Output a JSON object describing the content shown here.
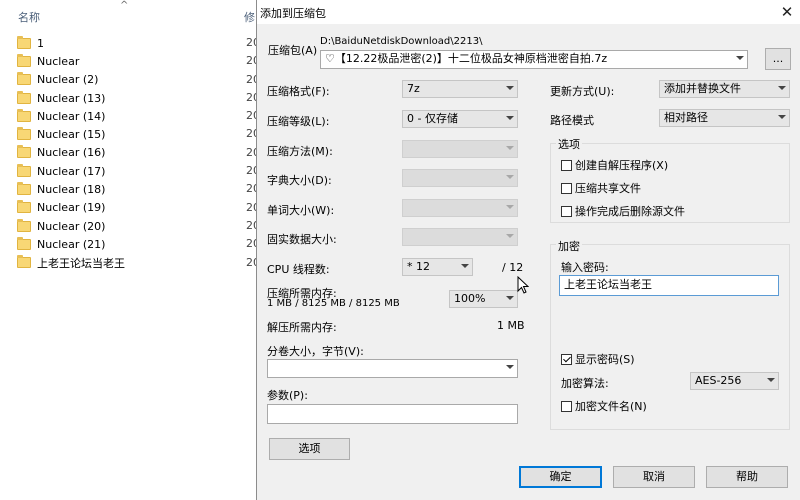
{
  "explorer": {
    "column_name": "名称",
    "column_modified": "修",
    "files": [
      {
        "name": "1",
        "date": ""
      },
      {
        "name": "Nuclear",
        "date": ""
      },
      {
        "name": "Nuclear (2)",
        "date": "20"
      },
      {
        "name": "Nuclear (13)",
        "date": "20"
      },
      {
        "name": "Nuclear (14)",
        "date": "20"
      },
      {
        "name": "Nuclear (15)",
        "date": "20"
      },
      {
        "name": "Nuclear (16)",
        "date": "20"
      },
      {
        "name": "Nuclear (17)",
        "date": "20"
      },
      {
        "name": "Nuclear (18)",
        "date": "20"
      },
      {
        "name": "Nuclear (19)",
        "date": "20"
      },
      {
        "name": "Nuclear (20)",
        "date": "20"
      },
      {
        "name": "Nuclear (21)",
        "date": "20"
      },
      {
        "name": "上老王论坛当老王",
        "date": "20"
      }
    ],
    "date_top": [
      "20",
      "20"
    ]
  },
  "dialog": {
    "title": "添加到压缩包",
    "archive_label": "压缩包(A)",
    "archive_dir": "D:\\BaiduNetdiskDownload\\2213\\",
    "archive_name": "♡【12.22极品泄密(2)】十二位极品女神原档泄密自拍.7z",
    "browse_label": "...",
    "format_label": "压缩格式(F):",
    "format_value": "7z",
    "level_label": "压缩等级(L):",
    "level_value": "0 - 仅存储",
    "method_label": "压缩方法(M):",
    "dict_label": "字典大小(D):",
    "word_label": "单词大小(W):",
    "solid_label": "固实数据大小:",
    "cpu_label": "CPU 线程数:",
    "cpu_value": "* 12",
    "cpu_total": "/ 12",
    "mem_comp_label": "压缩所需内存:",
    "mem_comp_value": "1 MB / 8125 MB / 8125 MB",
    "mem_comp_percent": "100%",
    "mem_decomp_label": "解压所需内存:",
    "mem_decomp_value": "1 MB",
    "split_label": "分卷大小，字节(V):",
    "split_value": "",
    "params_label": "参数(P):",
    "params_value": "",
    "options_btn": "选项",
    "update_label": "更新方式(U):",
    "update_value": "添加并替换文件",
    "path_label": "路径模式",
    "path_value": "相对路径",
    "options_group": "选项",
    "opt_sfx": "创建自解压程序(X)",
    "opt_shared": "压缩共享文件",
    "opt_delete": "操作完成后删除源文件",
    "encrypt_group": "加密",
    "password_label": "输入密码:",
    "password_value": "上老王论坛当老王",
    "show_password": "显示密码(S)",
    "enc_method_label": "加密算法:",
    "enc_method_value": "AES-256",
    "enc_names": "加密文件名(N)",
    "ok": "确定",
    "cancel": "取消",
    "help": "帮助",
    "close_icon": "✕"
  }
}
